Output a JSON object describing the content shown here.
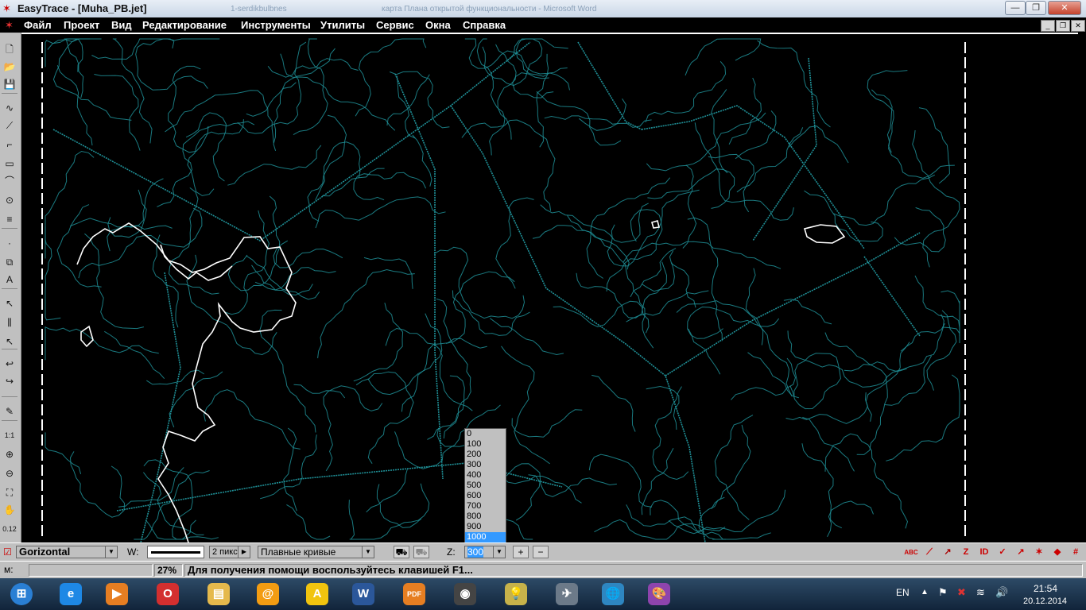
{
  "window": {
    "title": "EasyTrace - [Muha_PB.jet]",
    "ghost_tab_1": "1-serdikbulbnes",
    "ghost_tab_2": "карта Плана открытой функциональности - Microsoft Word",
    "min_label": "—",
    "max_label": "❐",
    "close_label": "✕"
  },
  "menu": {
    "items": [
      "Файл",
      "Проект",
      "Вид",
      "Редактирование",
      "Инструменты",
      "Утилиты",
      "Сервис",
      "Окна",
      "Справка"
    ],
    "mdi_min": "_",
    "mdi_restore": "❐",
    "mdi_close": "✕"
  },
  "left_tools": [
    {
      "name": "new-file-icon",
      "glyph": "🗋"
    },
    {
      "name": "open-folder-icon",
      "glyph": "📂"
    },
    {
      "name": "save-icon",
      "glyph": "💾"
    },
    {
      "name": "curve-tool-icon",
      "glyph": "∿"
    },
    {
      "name": "polyline-tool-icon",
      "glyph": "⟋"
    },
    {
      "name": "step-line-tool-icon",
      "glyph": "⌐"
    },
    {
      "name": "rectangle-tool-icon",
      "glyph": "▭"
    },
    {
      "name": "arc-tool-icon",
      "glyph": "⌒"
    },
    {
      "name": "circle-tool-icon",
      "glyph": "⊙"
    },
    {
      "name": "hatch-tool-icon",
      "glyph": "≡"
    },
    {
      "name": "point-tool-icon",
      "glyph": "·"
    },
    {
      "name": "object-tool-icon",
      "glyph": "⧉"
    },
    {
      "name": "text-tool-icon",
      "glyph": "A"
    },
    {
      "name": "select-arrow-icon",
      "glyph": "↖"
    },
    {
      "name": "multi-select-icon",
      "glyph": "⫼"
    },
    {
      "name": "select-node-icon",
      "glyph": "↖"
    },
    {
      "name": "undo-arrow-icon",
      "glyph": "↩"
    },
    {
      "name": "redo-arrow-icon",
      "glyph": "↪"
    },
    {
      "name": "pencil-icon",
      "glyph": "✎"
    },
    {
      "name": "zoom-1-1-icon",
      "glyph": "1:1"
    },
    {
      "name": "zoom-in-icon",
      "glyph": "⊕"
    },
    {
      "name": "zoom-out-icon",
      "glyph": "⊖"
    },
    {
      "name": "zoom-extent-icon",
      "glyph": "⛶"
    },
    {
      "name": "pan-hand-icon",
      "glyph": "✋"
    },
    {
      "name": "coordinates-icon",
      "glyph": "0.12"
    }
  ],
  "bottom_toolbar": {
    "layer_value": "Gorizontal",
    "width_label": "W:",
    "width_value": "2 пикс",
    "curve_mode": "Плавные кривые",
    "z_label": "Z:",
    "z_value": "300",
    "plus_label": "+",
    "minus_label": "−",
    "right_icons": [
      "ABC",
      "⟋",
      "↗",
      "Z",
      "ID",
      "✓",
      "↗",
      "✶",
      "◆",
      "#"
    ]
  },
  "z_dropdown": {
    "options": [
      "0",
      "100",
      "200",
      "300",
      "400",
      "500",
      "600",
      "700",
      "800",
      "900",
      "1000"
    ],
    "selected": "1000"
  },
  "statusbar": {
    "mode_label": "м:",
    "coords_value": "",
    "zoom_value": "27%",
    "help_text": "Для получения помощи воспользуйтесь клавишей F1..."
  },
  "taskbar": {
    "apps": [
      {
        "name": "start-button",
        "glyph": "⊞",
        "color": "#2a7fd4"
      },
      {
        "name": "internet-explorer-icon",
        "glyph": "e",
        "color": "#1e88e5"
      },
      {
        "name": "media-player-icon",
        "glyph": "▶",
        "color": "#e67e22"
      },
      {
        "name": "opera-icon",
        "glyph": "O",
        "color": "#d32f2f"
      },
      {
        "name": "file-explorer-icon",
        "glyph": "▤",
        "color": "#e5b94c"
      },
      {
        "name": "mail-agent-icon",
        "glyph": "@",
        "color": "#f39c12"
      },
      {
        "name": "autocad-icon",
        "glyph": "A",
        "color": "#f1c40f"
      },
      {
        "name": "word-icon",
        "glyph": "W",
        "color": "#2b579a"
      },
      {
        "name": "pdf-icon",
        "glyph": "PDF",
        "color": "#e67e22"
      },
      {
        "name": "camera-app-icon",
        "glyph": "◉",
        "color": "#444444"
      },
      {
        "name": "bulb-app-icon",
        "glyph": "💡",
        "color": "#c7b24a"
      },
      {
        "name": "paper-plane-app-icon",
        "glyph": "✈",
        "color": "#6c7a89"
      },
      {
        "name": "globe-app-icon",
        "glyph": "🌐",
        "color": "#2e86c1"
      },
      {
        "name": "paint-palette-icon",
        "glyph": "🎨",
        "color": "#8e44ad"
      }
    ],
    "language": "EN",
    "time": "21:54",
    "date": "20.12.2014"
  },
  "colors": {
    "contour": "#1f8f96",
    "white_line": "#ffffff",
    "toolbar": "#c0c0c0",
    "selection": "#3399ff"
  }
}
